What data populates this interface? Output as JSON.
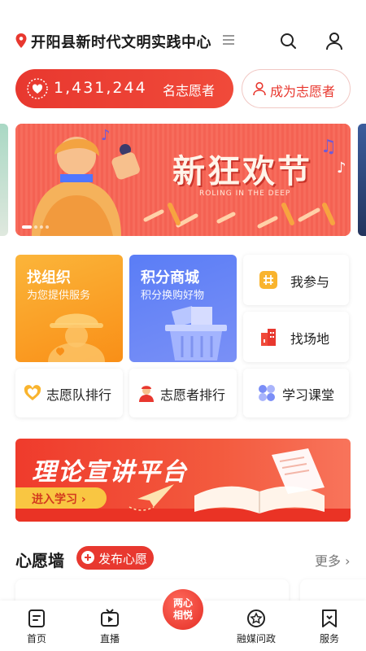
{
  "header": {
    "location": "开阳县新时代文明实践中心",
    "icons": [
      "location-pin-icon",
      "menu-icon",
      "search-icon",
      "user-icon"
    ]
  },
  "volunteer": {
    "count": "1,431,244",
    "count_label": "名志愿者",
    "become_label": "成为志愿者"
  },
  "banner": {
    "title": "新狂欢节",
    "subtitle": "ROLING IN THE DEEP",
    "page_count": 4,
    "active_index": 0
  },
  "grid": {
    "find_org": {
      "title": "找组织",
      "subtitle": "为您提供服务"
    },
    "points_mall": {
      "title": "积分商城",
      "subtitle": "积分换购好物"
    },
    "my_participation": "我参与",
    "find_venue": "找场地",
    "team_ranking": "志愿队排行",
    "volunteer_ranking": "志愿者排行",
    "study_class": "学习课堂"
  },
  "promo": {
    "title": "理论宣讲平台",
    "button": "进入学习 ›"
  },
  "wish_wall": {
    "title": "心愿墙",
    "publish_label": "发布心愿",
    "more_label": "更多 ›"
  },
  "bottom_nav": {
    "items": [
      {
        "label": "首页",
        "icon": "home-icon"
      },
      {
        "label": "直播",
        "icon": "live-tv-icon"
      },
      {
        "label": "融媒问政",
        "icon": "star-badge-icon"
      },
      {
        "label": "服务",
        "icon": "bookmark-icon"
      }
    ],
    "center_label_line1": "两心",
    "center_label_line2": "相悦"
  },
  "colors": {
    "brand_red": "#e8382f",
    "orange": "#f98f17",
    "blue": "#5a7df6"
  }
}
